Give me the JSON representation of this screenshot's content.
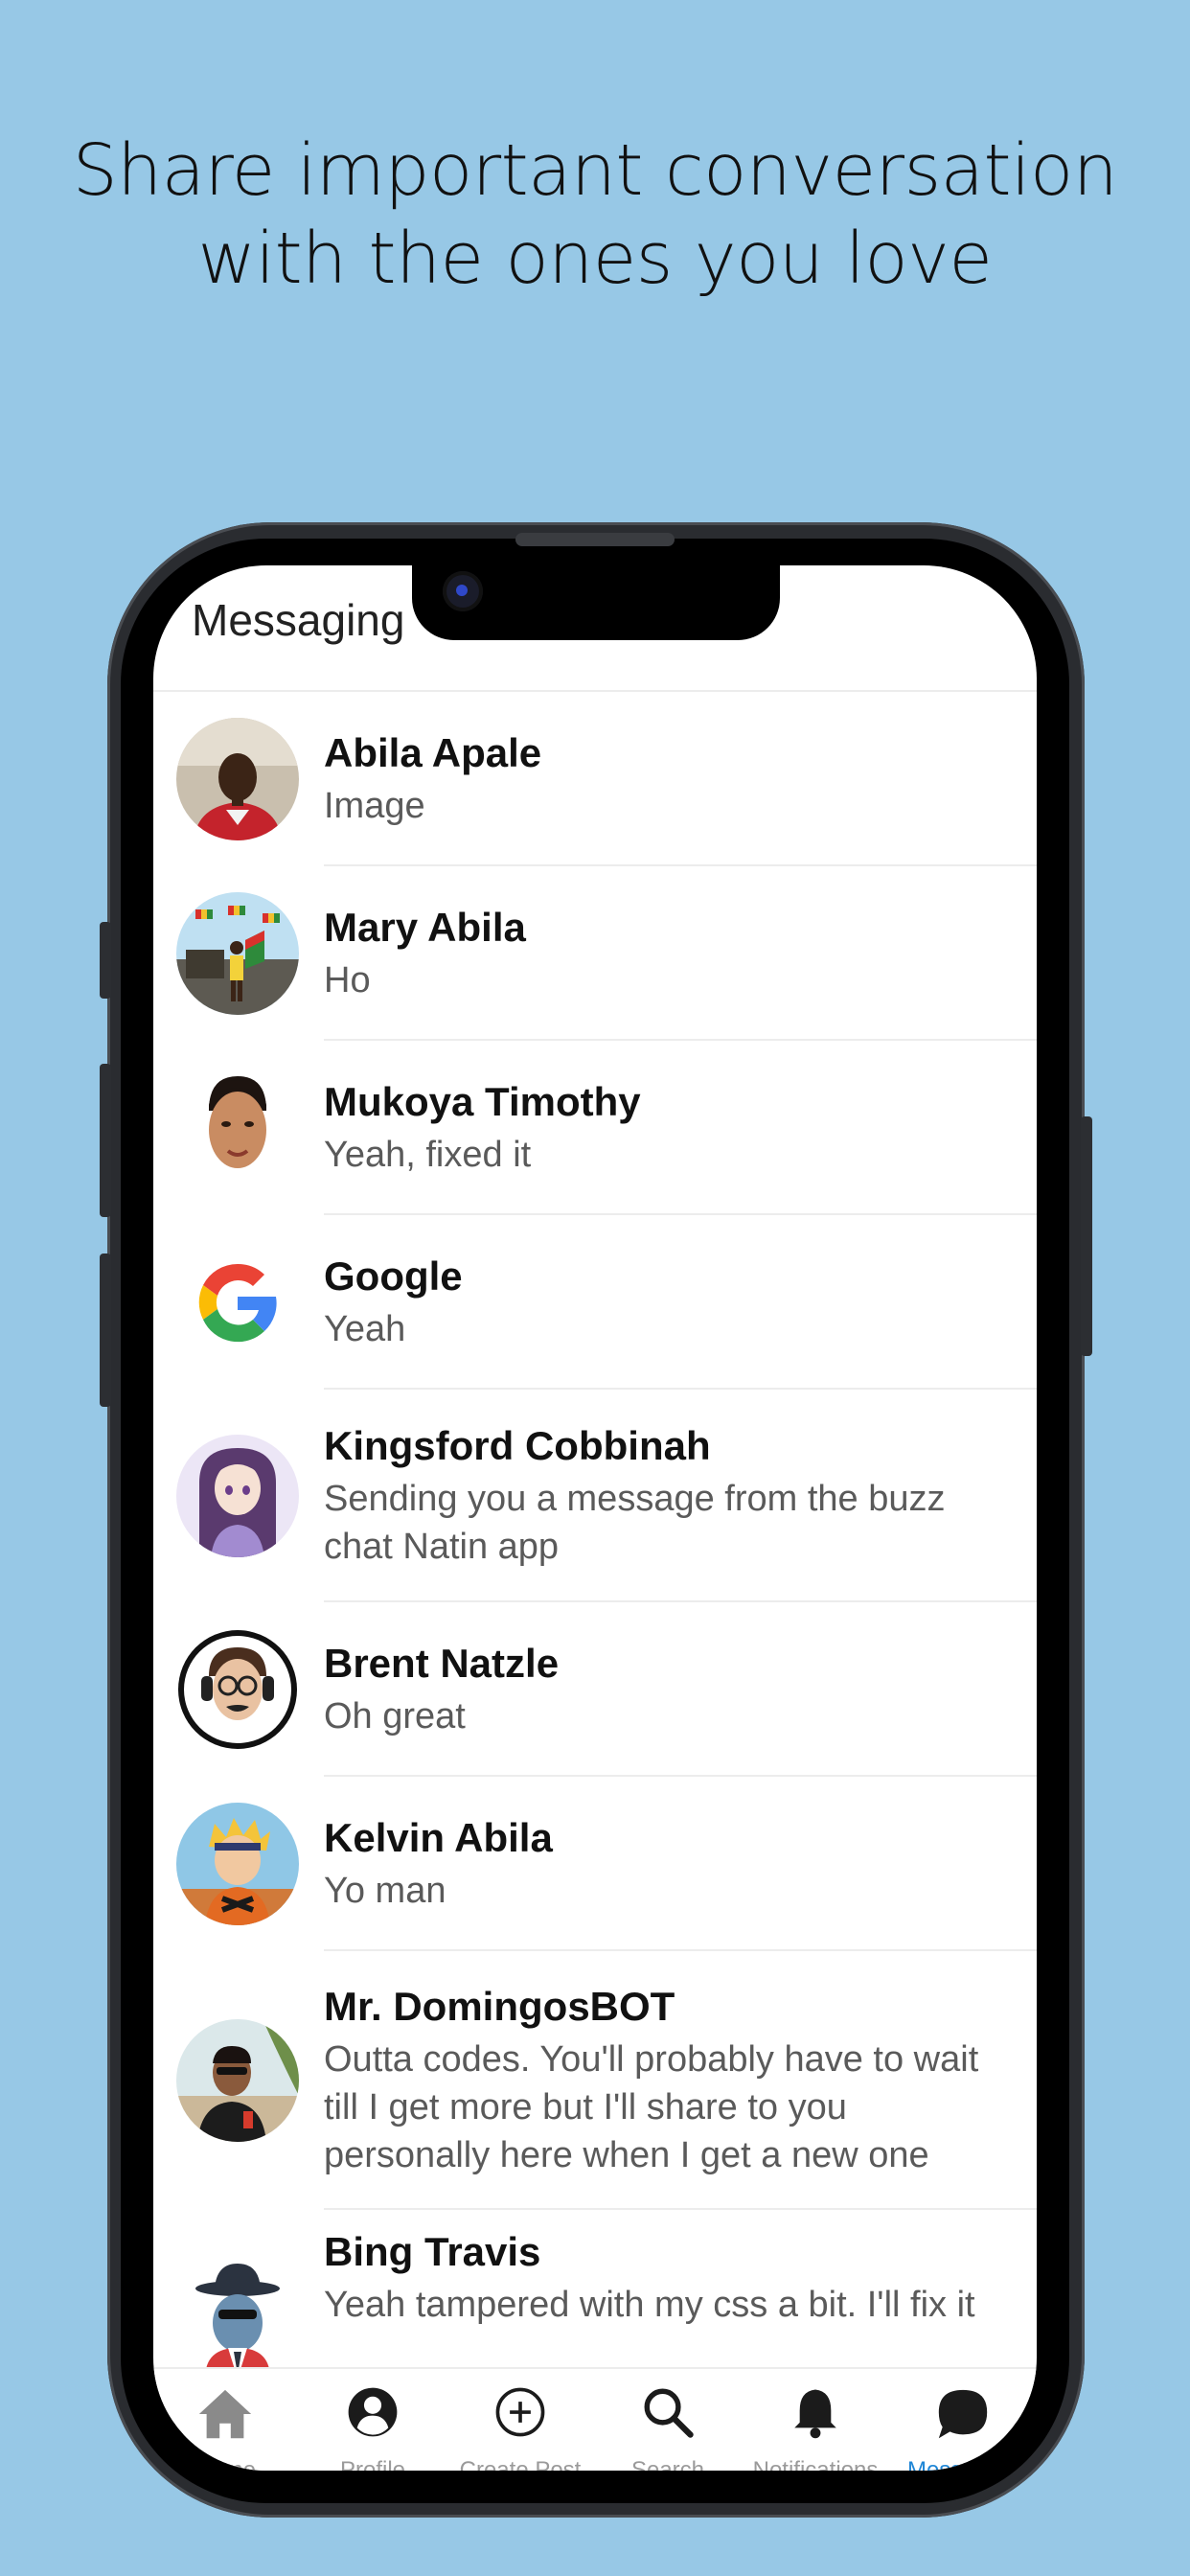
{
  "headline": {
    "line1": "Share important conversation",
    "line2": "with the ones you love"
  },
  "app": {
    "title": "Messaging"
  },
  "conversations": [
    {
      "name": "Abila Apale",
      "message": "Image",
      "avatar": "photo-man-red-shirt"
    },
    {
      "name": "Mary Abila",
      "message": "Ho",
      "avatar": "photo-woman-flags"
    },
    {
      "name": "Mukoya Timothy",
      "message": "Yeah, fixed it",
      "avatar": "cartoon-man-face"
    },
    {
      "name": "Google",
      "message": "Yeah",
      "avatar": "google-logo"
    },
    {
      "name": "Kingsford Cobbinah",
      "message": "Sending you a message from the buzz chat Natin app",
      "avatar": "anime-girl"
    },
    {
      "name": "Brent Natzle",
      "message": "Oh great",
      "avatar": "cartoon-headphones"
    },
    {
      "name": "Kelvin Abila",
      "message": "Yo man",
      "avatar": "anime-ninja"
    },
    {
      "name": "Mr. DomingosBOT",
      "message": "Outta codes. You'll probably have to wait till I get more but I'll share to you personally here when I get a new one",
      "avatar": "photo-man-beach"
    },
    {
      "name": "Bing Travis",
      "message": "Yeah tampered with my css a bit. I'll fix it",
      "avatar": "cartoon-spy"
    }
  ],
  "nav": {
    "items": [
      {
        "label": "Home",
        "icon": "home-icon"
      },
      {
        "label": "Profile",
        "icon": "profile-icon"
      },
      {
        "label": "Create Post",
        "icon": "plus-circle-icon"
      },
      {
        "label": "Search",
        "icon": "search-icon"
      },
      {
        "label": "Notifications",
        "icon": "bell-icon"
      },
      {
        "label": "Messaging",
        "icon": "chat-icon"
      }
    ],
    "active_index": 5,
    "active_color": "#1f86d6",
    "icon_color": "#222222"
  },
  "colors": {
    "background": "#97c8e6"
  }
}
